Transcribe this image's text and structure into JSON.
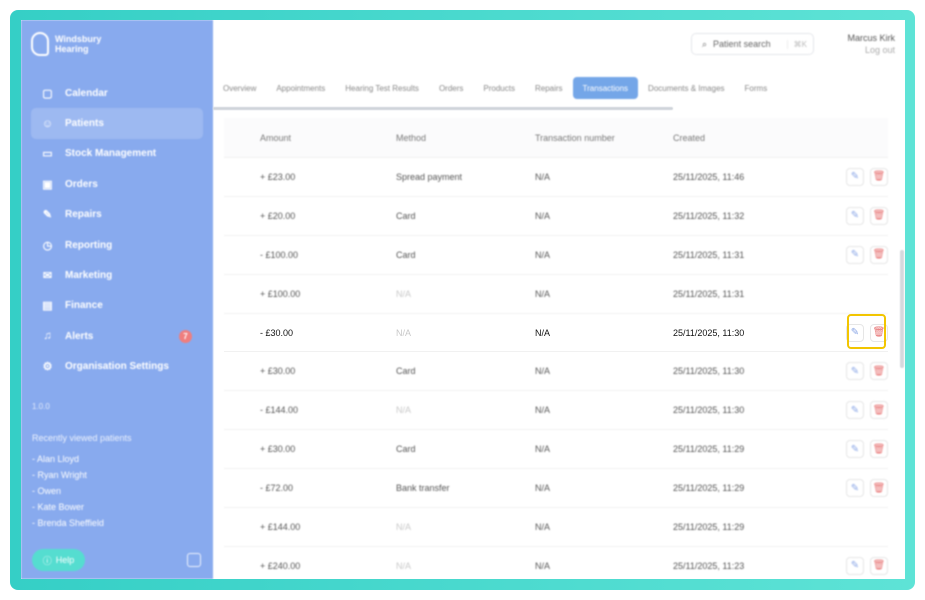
{
  "app": {
    "logo_text": "Windsbury Hearing"
  },
  "sidebar": {
    "items": [
      {
        "label": "Calendar",
        "icon": "calendar-icon",
        "glyph": "▢"
      },
      {
        "label": "Patients",
        "icon": "smile-icon",
        "glyph": "☺"
      },
      {
        "label": "Stock Management",
        "icon": "clipboard-icon",
        "glyph": "▭"
      },
      {
        "label": "Orders",
        "icon": "box-icon",
        "glyph": "▣"
      },
      {
        "label": "Repairs",
        "icon": "wrench-icon",
        "glyph": "✎"
      },
      {
        "label": "Reporting",
        "icon": "clock-icon",
        "glyph": "◷"
      },
      {
        "label": "Marketing",
        "icon": "mail-icon",
        "glyph": "✉"
      },
      {
        "label": "Finance",
        "icon": "card-icon",
        "glyph": "▤"
      },
      {
        "label": "Alerts",
        "icon": "bell-icon",
        "glyph": "♫",
        "badge": "7"
      },
      {
        "label": "Organisation Settings",
        "icon": "gear-icon",
        "glyph": "⚙"
      }
    ],
    "active_index": 1,
    "version": "1.0.0",
    "recent_title": "Recently viewed patients",
    "recent": [
      "- Alan Lloyd",
      "- Ryan Wright",
      "- Owen",
      "- Kate Bower",
      "- Brenda Sheffield"
    ],
    "help_label": "Help"
  },
  "header": {
    "search_placeholder": "Patient search",
    "search_shortcut": "⌘K",
    "user_name": "Marcus Kirk",
    "logout_label": "Log out"
  },
  "tabs": [
    "Overview",
    "Appointments",
    "Hearing Test Results",
    "Orders",
    "Products",
    "Repairs",
    "Transactions",
    "Documents & Images",
    "Forms"
  ],
  "active_tab": "Transactions",
  "table": {
    "columns": [
      "Amount",
      "Method",
      "Transaction number",
      "Created"
    ],
    "rows": [
      {
        "amount": "+ £23.00",
        "method": "Spread payment",
        "method_muted": false,
        "txn": "N/A",
        "created": "25/11/2025, 11:46",
        "actions": true
      },
      {
        "amount": "+ £20.00",
        "method": "Card",
        "method_muted": false,
        "txn": "N/A",
        "created": "25/11/2025, 11:32",
        "actions": true
      },
      {
        "amount": "- £100.00",
        "method": "Card",
        "method_muted": false,
        "txn": "N/A",
        "created": "25/11/2025, 11:31",
        "actions": true
      },
      {
        "amount": "+ £100.00",
        "method": "N/A",
        "method_muted": true,
        "txn": "N/A",
        "created": "25/11/2025, 11:31",
        "actions": false
      },
      {
        "amount": "- £30.00",
        "method": "N/A",
        "method_muted": true,
        "txn": "N/A",
        "created": "25/11/2025, 11:30",
        "actions": true,
        "focused": true
      },
      {
        "amount": "+ £30.00",
        "method": "Card",
        "method_muted": false,
        "txn": "N/A",
        "created": "25/11/2025, 11:30",
        "actions": true
      },
      {
        "amount": "- £144.00",
        "method": "N/A",
        "method_muted": true,
        "txn": "N/A",
        "created": "25/11/2025, 11:30",
        "actions": true
      },
      {
        "amount": "+ £30.00",
        "method": "Card",
        "method_muted": false,
        "txn": "N/A",
        "created": "25/11/2025, 11:29",
        "actions": true
      },
      {
        "amount": "- £72.00",
        "method": "Bank transfer",
        "method_muted": false,
        "txn": "N/A",
        "created": "25/11/2025, 11:29",
        "actions": true
      },
      {
        "amount": "+ £144.00",
        "method": "N/A",
        "method_muted": true,
        "txn": "N/A",
        "created": "25/11/2025, 11:29",
        "actions": false
      },
      {
        "amount": "+ £240.00",
        "method": "N/A",
        "method_muted": true,
        "txn": "N/A",
        "created": "25/11/2025, 11:23",
        "actions": true
      }
    ]
  },
  "colors": {
    "frame": "#35cfc6",
    "sidebar": "#88aaee",
    "active_tab": "#74a6e8",
    "highlight": "#f2c500",
    "delete": "#e67070"
  }
}
